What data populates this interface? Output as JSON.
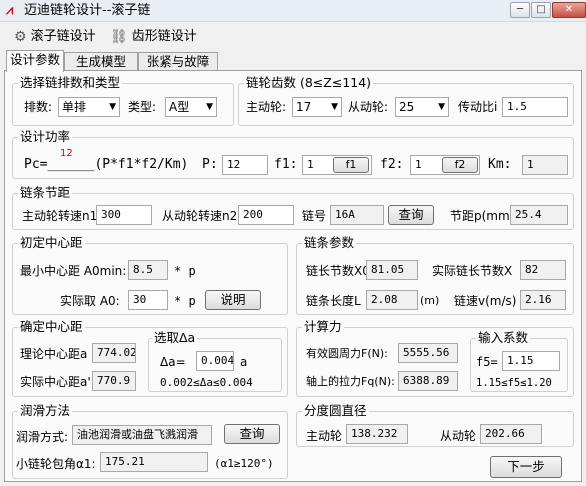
{
  "window": {
    "title": "迈迪链轮设计--滚子链",
    "min": "─",
    "max": "□",
    "close": "✕"
  },
  "toolbar": {
    "roller": "滚子链设计",
    "tooth": "齿形链设计"
  },
  "tabs": [
    "设计参数",
    "生成模型",
    "张紧与故障"
  ],
  "g1": {
    "title": "选择链排数和类型",
    "rows_label": "排数:",
    "rows_value": "单排",
    "type_label": "类型:",
    "type_value": "A型"
  },
  "g2": {
    "title": "链轮齿数 (8≤Z≤114)",
    "drive_label": "主动轮:",
    "drive_value": "17",
    "driven_label": "从动轮:",
    "driven_value": "25",
    "ratio_label": "传动比i",
    "ratio_value": "1.5"
  },
  "g3": {
    "title": "设计功率",
    "red": "12",
    "formula": "Pc=______(P*f1*f2/Km)",
    "p_label": "P:",
    "p_value": "12",
    "f1_label": "f1:",
    "f1_value": "1",
    "f1_btn": "f1",
    "f2_label": "f2:",
    "f2_value": "1",
    "f2_btn": "f2",
    "km_label": "Km:",
    "km_value": "1"
  },
  "g4": {
    "title": "链条节距",
    "n1_label": "主动轮转速n1",
    "n1_value": "300",
    "n2_label": "从动轮转速n2",
    "n2_value": "200",
    "chain_label": "链号",
    "chain_value": "16A",
    "query": "查询",
    "pitch_label": "节距p(mm)",
    "pitch_value": "25.4"
  },
  "g5": {
    "title": "初定中心距",
    "min_label": "最小中心距 A0min:",
    "min_value": "8.5",
    "min_unit": "* p",
    "act_label": "实际取 A0:",
    "act_value": "30",
    "act_unit": "* p",
    "explain": "说明"
  },
  "g6": {
    "title": "链条参数",
    "x0_label": "链长节数X0",
    "x0_value": "81.05",
    "x_label": "实际链长节数X",
    "x_value": "82",
    "l_label": "链条长度L",
    "l_value": "2.08",
    "l_unit": "(m)",
    "v_label": "链速v(m/s)",
    "v_value": "2.16"
  },
  "g7": {
    "title": "确定中心距",
    "theory_label": "理论中心距a",
    "theory_value": "774.02",
    "actual_label": "实际中心距a'",
    "actual_value": "770.9",
    "sub_title": "选取Δa",
    "da_label": "Δa=",
    "da_value": "0.004",
    "da_unit": "a",
    "range": "0.002≤Δa≤0.004"
  },
  "g8": {
    "title": "计算力",
    "ft_label": "有效圆周力F(N):",
    "ft_value": "5555.56",
    "fq_label": "轴上的拉力Fq(N):",
    "fq_value": "6388.89",
    "input_title": "输入系数",
    "f5_label": "f5=",
    "f5_value": "1.15",
    "f5_range": "1.15≤f5≤1.20"
  },
  "g9": {
    "title": "润滑方法",
    "mode_label": "润滑方式:",
    "mode_value": "油池润滑或油盘飞溅润滑",
    "query": "查询",
    "angle_label": "小链轮包角α1:",
    "angle_value": "175.21",
    "angle_cond": "(α1≥120°)"
  },
  "g10": {
    "title": "分度圆直径",
    "drive_label": "主动轮",
    "drive_value": "138.232",
    "driven_label": "从动轮",
    "driven_value": "202.66"
  },
  "next": "下一步"
}
